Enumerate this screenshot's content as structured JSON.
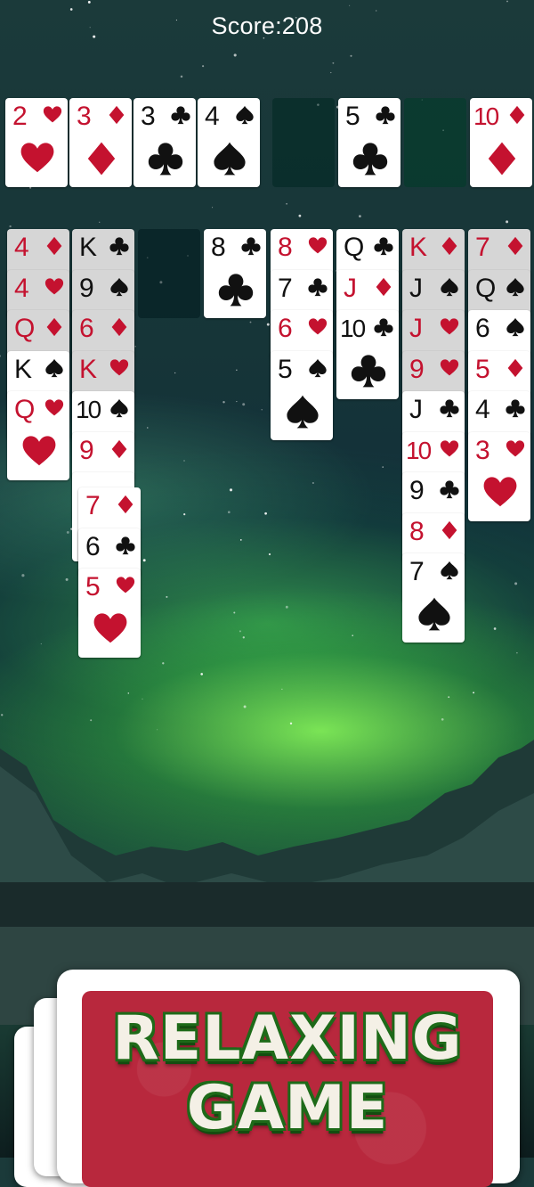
{
  "score_text": "Score:208",
  "colors": {
    "red_suit": "#c4122f",
    "black_suit": "#111111",
    "promo_red": "#b8283d",
    "promo_text_outline": "#1e6a19"
  },
  "top_row": [
    {
      "rank": "2",
      "suit": "hearts"
    },
    {
      "rank": "3",
      "suit": "diamonds"
    },
    {
      "rank": "3",
      "suit": "clubs"
    },
    {
      "rank": "4",
      "suit": "spades"
    },
    {
      "empty": true
    },
    {
      "rank": "5",
      "suit": "clubs"
    },
    {
      "empty": true
    },
    {
      "rank": "10",
      "suit": "diamonds"
    }
  ],
  "tableau": [
    [
      {
        "rank": "4",
        "suit": "diamonds",
        "shaded": true
      },
      {
        "rank": "4",
        "suit": "hearts",
        "shaded": true
      },
      {
        "rank": "Q",
        "suit": "diamonds",
        "shaded": true
      },
      {
        "rank": "K",
        "suit": "spades",
        "shaded": false
      },
      {
        "rank": "Q",
        "suit": "hearts",
        "shaded": false
      }
    ],
    [
      {
        "rank": "K",
        "suit": "clubs",
        "shaded": true
      },
      {
        "rank": "9",
        "suit": "spades",
        "shaded": true
      },
      {
        "rank": "6",
        "suit": "diamonds",
        "shaded": true
      },
      {
        "rank": "K",
        "suit": "hearts",
        "shaded": true
      },
      {
        "rank": "10",
        "suit": "spades",
        "shaded": false
      },
      {
        "rank": "9",
        "suit": "diamonds",
        "shaded": false
      },
      {
        "rank": "",
        "suit": "",
        "shaded": false
      }
    ],
    [],
    [
      {
        "rank": "8",
        "suit": "clubs",
        "shaded": false
      }
    ],
    [
      {
        "rank": "8",
        "suit": "hearts",
        "shaded": false
      },
      {
        "rank": "7",
        "suit": "clubs",
        "shaded": false
      },
      {
        "rank": "6",
        "suit": "hearts",
        "shaded": false
      },
      {
        "rank": "5",
        "suit": "spades",
        "shaded": false
      }
    ],
    [
      {
        "rank": "Q",
        "suit": "clubs",
        "shaded": false
      },
      {
        "rank": "J",
        "suit": "diamonds",
        "shaded": false
      },
      {
        "rank": "10",
        "suit": "clubs",
        "shaded": false
      }
    ],
    [
      {
        "rank": "K",
        "suit": "diamonds",
        "shaded": true
      },
      {
        "rank": "J",
        "suit": "spades",
        "shaded": true
      },
      {
        "rank": "J",
        "suit": "hearts",
        "shaded": true
      },
      {
        "rank": "9",
        "suit": "hearts",
        "shaded": true
      },
      {
        "rank": "J",
        "suit": "clubs",
        "shaded": false
      },
      {
        "rank": "10",
        "suit": "hearts",
        "shaded": false
      },
      {
        "rank": "9",
        "suit": "clubs",
        "shaded": false
      },
      {
        "rank": "8",
        "suit": "diamonds",
        "shaded": false
      },
      {
        "rank": "7",
        "suit": "spades",
        "shaded": false
      }
    ],
    [
      {
        "rank": "7",
        "suit": "diamonds",
        "shaded": true
      },
      {
        "rank": "Q",
        "suit": "spades",
        "shaded": true
      },
      {
        "rank": "6",
        "suit": "spades",
        "shaded": false
      },
      {
        "rank": "5",
        "suit": "diamonds",
        "shaded": false
      },
      {
        "rank": "4",
        "suit": "clubs",
        "shaded": false
      },
      {
        "rank": "3",
        "suit": "hearts",
        "shaded": false
      }
    ]
  ],
  "dragged_stack": [
    {
      "rank": "7",
      "suit": "diamonds"
    },
    {
      "rank": "6",
      "suit": "clubs"
    },
    {
      "rank": "5",
      "suit": "hearts"
    }
  ],
  "promo": {
    "line1": "RELAXING",
    "line2": "GAME"
  }
}
